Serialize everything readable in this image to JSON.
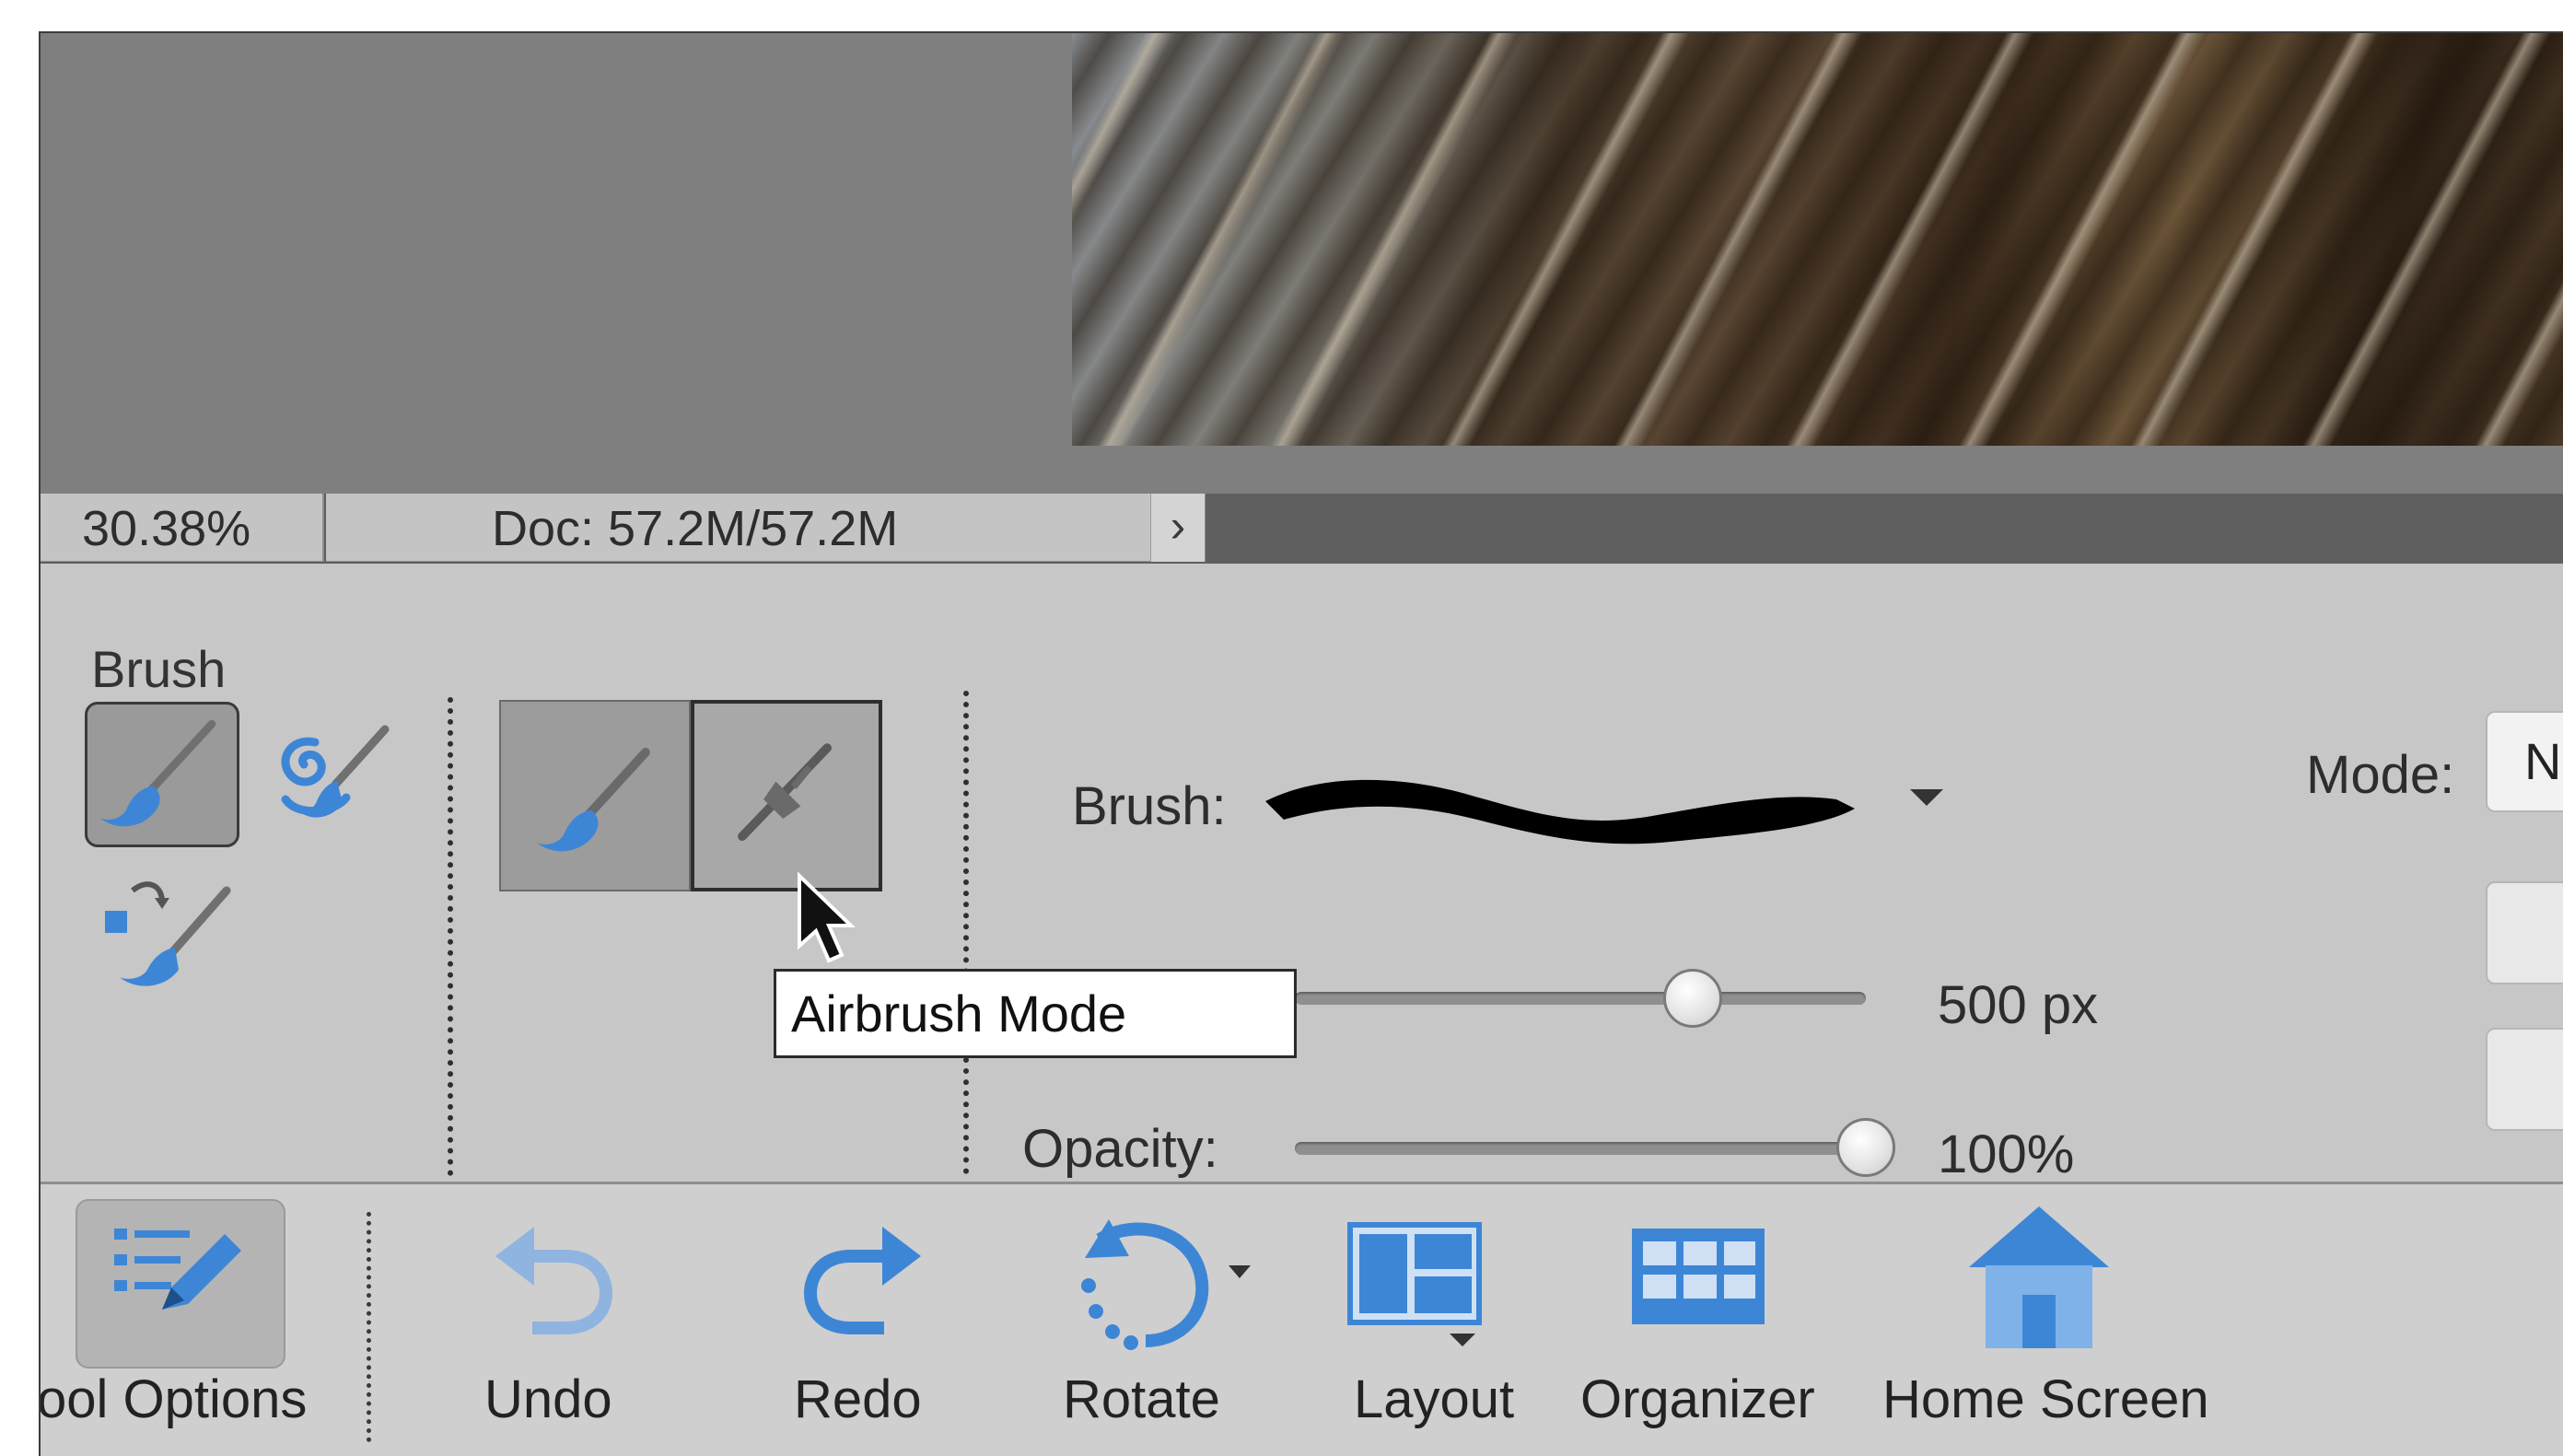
{
  "status_bar": {
    "zoom": "30.38%",
    "doc_info": "Doc: 57.2M/57.2M",
    "arrow": "›"
  },
  "tool_options": {
    "group_label": "Brush",
    "tools": [
      {
        "name": "brush-tool",
        "icon": "paintbrush-icon",
        "selected": true
      },
      {
        "name": "impressionist-brush-tool",
        "icon": "swirl-brush-icon",
        "selected": false
      },
      {
        "name": "color-replacement-tool",
        "icon": "color-replace-icon",
        "selected": false
      }
    ],
    "brush_label": "Brush:",
    "size_value": "500 px",
    "size_fraction": 0.68,
    "opacity_label": "Opacity:",
    "opacity_value": "100%",
    "opacity_fraction": 1.0,
    "mode_label": "Mode:",
    "mode_value": "N",
    "tooltip": "Airbrush Mode"
  },
  "task_bar": {
    "items": [
      {
        "label": "ool Options",
        "icon": "tool-options-icon"
      },
      {
        "label": "Undo",
        "icon": "undo-icon"
      },
      {
        "label": "Redo",
        "icon": "redo-icon"
      },
      {
        "label": "Rotate",
        "icon": "rotate-icon"
      },
      {
        "label": "Layout",
        "icon": "layout-icon"
      },
      {
        "label": "Organizer",
        "icon": "organizer-icon"
      },
      {
        "label": "Home Screen",
        "icon": "home-icon"
      }
    ]
  },
  "colors": {
    "accent_blue": "#3d86d6",
    "panel_gray": "#c7c7c7"
  }
}
